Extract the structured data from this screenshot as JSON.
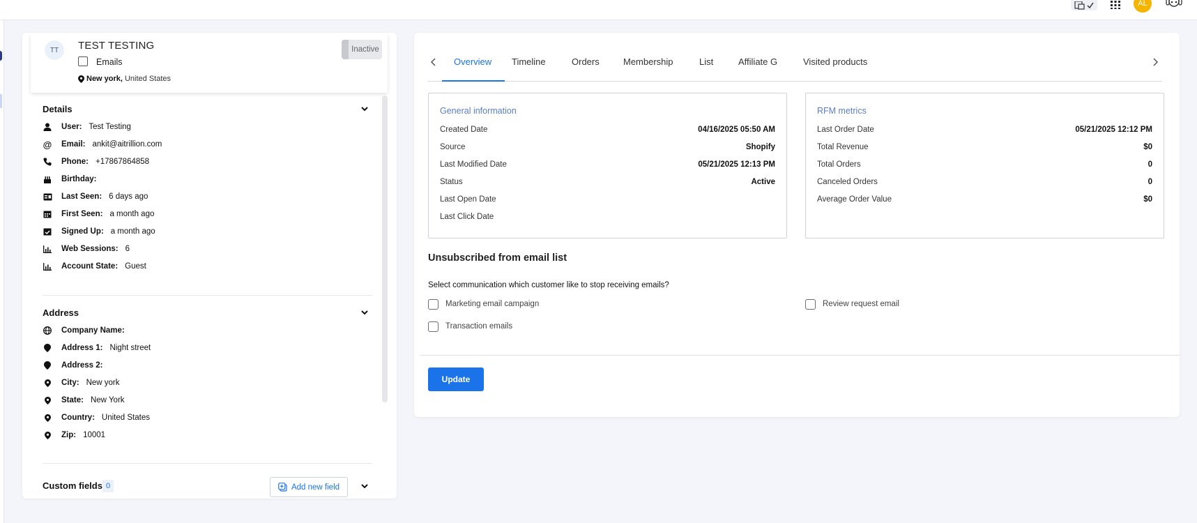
{
  "topbar": {
    "avatar_initials": "AL",
    "icons": [
      "translate-icon",
      "check-icon",
      "grid-icon",
      "robot-icon"
    ]
  },
  "profile": {
    "initials": "TT",
    "name": "TEST TESTING",
    "emails_label": "Emails",
    "city": "New york,",
    "country": "United States",
    "status_badge": "Inactive"
  },
  "details": {
    "title": "Details",
    "rows": [
      {
        "label": "User:",
        "value": "Test Testing",
        "icon": "user-icon"
      },
      {
        "label": "Email:",
        "value": "ankit@aitrillion.com",
        "icon": "at-icon"
      },
      {
        "label": "Phone:",
        "value": "+17867864858",
        "icon": "phone-icon"
      },
      {
        "label": "Birthday:",
        "value": "",
        "icon": "cake-icon"
      },
      {
        "label": "Last Seen:",
        "value": "6 days ago",
        "icon": "id-card-icon"
      },
      {
        "label": "First Seen:",
        "value": "a month ago",
        "icon": "calendar-icon"
      },
      {
        "label": "Signed Up:",
        "value": "a month ago",
        "icon": "calendar-check-icon"
      },
      {
        "label": "Web Sessions:",
        "value": "6",
        "icon": "bar-chart-icon"
      },
      {
        "label": "Account State:",
        "value": "Guest",
        "icon": "bar-chart-icon"
      }
    ]
  },
  "address": {
    "title": "Address",
    "rows": [
      {
        "label": "Company Name:",
        "value": "",
        "icon": "globe-icon"
      },
      {
        "label": "Address 1:",
        "value": "Night street",
        "icon": "map-marker-icon"
      },
      {
        "label": "Address 2:",
        "value": "",
        "icon": "map-marker-icon"
      },
      {
        "label": "City:",
        "value": "New york",
        "icon": "map-pin-icon"
      },
      {
        "label": "State:",
        "value": "New York",
        "icon": "map-pin-icon"
      },
      {
        "label": "Country:",
        "value": "United States",
        "icon": "map-pin-icon"
      },
      {
        "label": "Zip:",
        "value": "10001",
        "icon": "map-pin-icon"
      }
    ]
  },
  "custom_fields": {
    "title": "Custom fields",
    "count": "0",
    "add_button": "Add new field"
  },
  "tabs": [
    "Overview",
    "Timeline",
    "Orders",
    "Membership",
    "List",
    "Affiliate G",
    "Visited products"
  ],
  "general_info": {
    "title": "General information",
    "rows": [
      {
        "label": "Created Date",
        "value": "04/16/2025 05:50 AM"
      },
      {
        "label": "Source",
        "value": "Shopify"
      },
      {
        "label": "Last Modified Date",
        "value": "05/21/2025 12:13 PM"
      },
      {
        "label": "Status",
        "value": "Active"
      },
      {
        "label": "Last Open Date",
        "value": ""
      },
      {
        "label": "Last Click Date",
        "value": ""
      }
    ]
  },
  "rfm": {
    "title": "RFM metrics",
    "rows": [
      {
        "label": "Last Order Date",
        "value": "05/21/2025 12:12 PM"
      },
      {
        "label": "Total Revenue",
        "value": "$0"
      },
      {
        "label": "Total Orders",
        "value": "0"
      },
      {
        "label": "Canceled Orders",
        "value": "0"
      },
      {
        "label": "Average Order Value",
        "value": "$0"
      }
    ]
  },
  "unsubscribe": {
    "title": "Unsubscribed from email list",
    "question": "Select communication which customer like to stop receiving emails?",
    "options": [
      "Marketing email campaign",
      "Review request email",
      "Transaction emails"
    ],
    "update_button": "Update"
  }
}
